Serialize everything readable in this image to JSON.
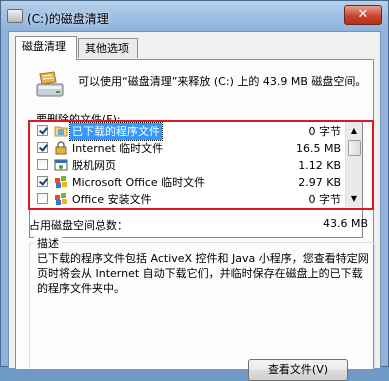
{
  "window": {
    "title": "(C:)的磁盘清理",
    "close_glyph": "✕"
  },
  "tabs": [
    {
      "label": "磁盘清理",
      "active": true
    },
    {
      "label": "其他选项",
      "active": false
    }
  ],
  "info": {
    "text": "可以使用“磁盘清理”来释放 (C:) 上的 43.9 MB 磁盘空间。"
  },
  "files_label": "要删除的文件(F):",
  "files": [
    {
      "name": "已下载的程序文件",
      "size": "0 字节",
      "checked": true,
      "selected": true,
      "icon": "folder-icon"
    },
    {
      "name": "Internet 临时文件",
      "size": "16.5 MB",
      "checked": true,
      "selected": false,
      "icon": "lock-icon"
    },
    {
      "name": "脱机网页",
      "size": "1.12 KB",
      "checked": false,
      "selected": false,
      "icon": "offline-page-icon"
    },
    {
      "name": "Microsoft Office 临时文件",
      "size": "2.97 KB",
      "checked": true,
      "selected": false,
      "icon": "office-icon"
    },
    {
      "name": "Office 安装文件",
      "size": "0 字节",
      "checked": false,
      "selected": false,
      "icon": "office-setup-icon"
    }
  ],
  "scroll": {
    "up_glyph": "▲",
    "down_glyph": "▼"
  },
  "total": {
    "label": "占用磁盘空间总数：",
    "value": "43.6 MB"
  },
  "description": {
    "title": "描述",
    "text": "已下载的程序文件包括 ActiveX 控件和 Java 小程序，您查看特定网页时将会从 Internet 自动下载它们，并临时保存在磁盘上的已下载的程序文件夹中。"
  },
  "view_button": "查看文件(V)",
  "colors": {
    "highlight": "#e0181e",
    "selection": "#3399ff"
  }
}
